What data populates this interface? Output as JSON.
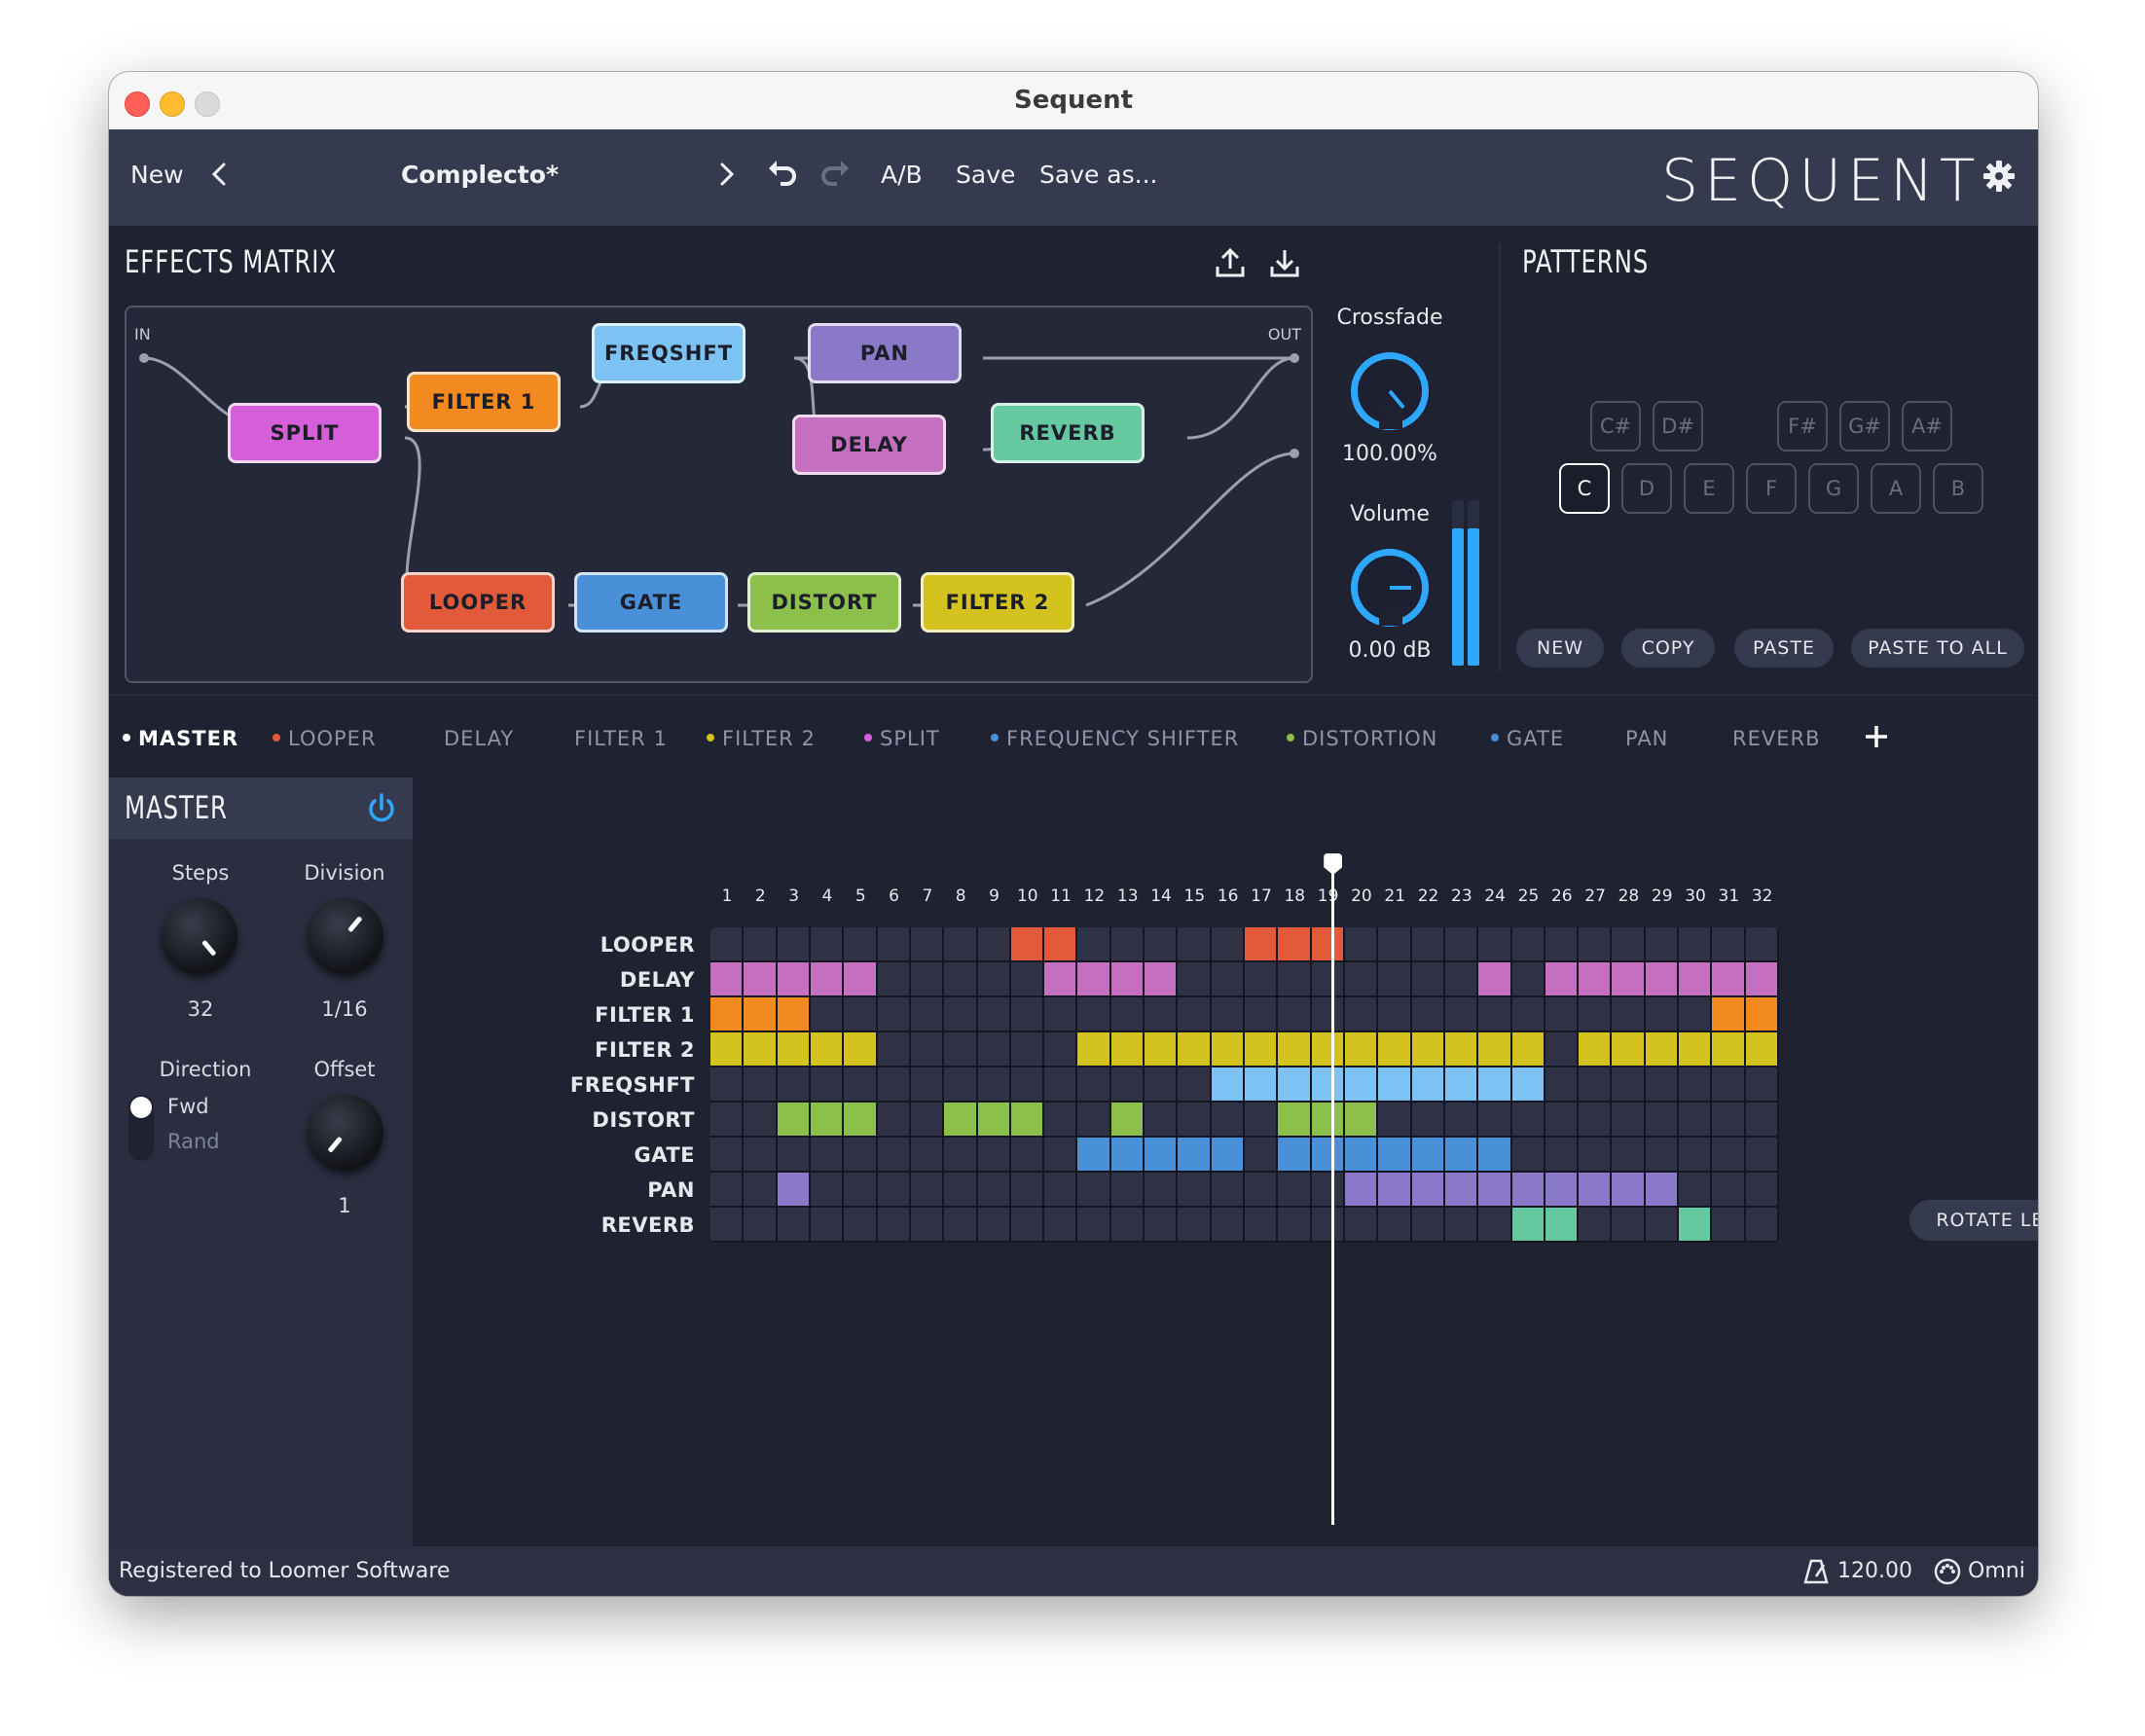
{
  "window": {
    "title": "Sequent"
  },
  "toolbar": {
    "new_label": "New",
    "preset_name": "Complecto*",
    "ab_label": "A/B",
    "save_label": "Save",
    "save_as_label": "Save as...",
    "brand": "SEQUENT"
  },
  "effects_matrix": {
    "title": "EFFECTS MATRIX",
    "in_label": "IN",
    "out_label": "OUT",
    "nodes": [
      {
        "id": "split",
        "label": "SPLIT",
        "color": "#d45fd8"
      },
      {
        "id": "filter1",
        "label": "FILTER 1",
        "color": "#f28a1f"
      },
      {
        "id": "freqshft",
        "label": "FREQSHFT",
        "color": "#7cc2f2"
      },
      {
        "id": "pan",
        "label": "PAN",
        "color": "#8a78c8"
      },
      {
        "id": "delay",
        "label": "DELAY",
        "color": "#c56fc0"
      },
      {
        "id": "reverb",
        "label": "REVERB",
        "color": "#66c8a0"
      },
      {
        "id": "looper",
        "label": "LOOPER",
        "color": "#e25a3a"
      },
      {
        "id": "gate",
        "label": "GATE",
        "color": "#4a90d8"
      },
      {
        "id": "distort",
        "label": "DISTORT",
        "color": "#8cc04a"
      },
      {
        "id": "filter2",
        "label": "FILTER 2",
        "color": "#d4c21e"
      }
    ],
    "crossfade_label": "Crossfade",
    "crossfade_value": "100.00%",
    "volume_label": "Volume",
    "volume_value": "0.00 dB",
    "crossfade_level": 1.0,
    "volume_level": 0.75,
    "meter_left_level": 0.83,
    "meter_right_level": 0.83
  },
  "patterns": {
    "title": "PATTERNS",
    "sharps": [
      "C#",
      "D#",
      "F#",
      "G#",
      "A#"
    ],
    "naturals": [
      "C",
      "D",
      "E",
      "F",
      "G",
      "A",
      "B"
    ],
    "active_note": "C",
    "buttons": {
      "new": "NEW",
      "copy": "COPY",
      "paste": "PASTE",
      "paste_all": "PASTE TO ALL"
    }
  },
  "tabs": [
    {
      "label": "MASTER",
      "dot": "#ffffff",
      "active": true
    },
    {
      "label": "LOOPER",
      "dot": "#e25a3a"
    },
    {
      "label": "DELAY",
      "dot": ""
    },
    {
      "label": "FILTER 1",
      "dot": ""
    },
    {
      "label": "FILTER 2",
      "dot": "#d4c21e"
    },
    {
      "label": "SPLIT",
      "dot": "#d45fd8"
    },
    {
      "label": "FREQUENCY SHIFTER",
      "dot": "#4a90d8"
    },
    {
      "label": "DISTORTION",
      "dot": "#8cc04a"
    },
    {
      "label": "GATE",
      "dot": "#4a90d8"
    },
    {
      "label": "PAN",
      "dot": ""
    },
    {
      "label": "REVERB",
      "dot": ""
    }
  ],
  "master": {
    "title": "MASTER",
    "steps_label": "Steps",
    "steps_value": "32",
    "division_label": "Division",
    "division_value": "1/16",
    "direction_label": "Direction",
    "direction_fwd": "Fwd",
    "direction_rand": "Rand",
    "offset_label": "Offset",
    "offset_value": "1"
  },
  "sequencer": {
    "steps": 32,
    "playhead_step": 19,
    "rows": [
      {
        "label": "LOOPER",
        "color": "#e25a3a",
        "on": [
          10,
          11,
          17,
          18,
          19
        ]
      },
      {
        "label": "DELAY",
        "color": "#c56fc0",
        "on": [
          1,
          2,
          3,
          4,
          5,
          11,
          12,
          13,
          14,
          24,
          26,
          27,
          28,
          29,
          30,
          31,
          32
        ]
      },
      {
        "label": "FILTER 1",
        "color": "#f28a1f",
        "on": [
          1,
          2,
          3,
          31,
          32
        ]
      },
      {
        "label": "FILTER 2",
        "color": "#d4c21e",
        "on": [
          1,
          2,
          3,
          4,
          5,
          12,
          13,
          14,
          15,
          16,
          17,
          18,
          19,
          20,
          21,
          22,
          23,
          24,
          25,
          27,
          28,
          29,
          30,
          31,
          32
        ]
      },
      {
        "label": "FREQSHFT",
        "color": "#7cc2f2",
        "on": [
          16,
          17,
          18,
          19,
          20,
          21,
          22,
          23,
          24,
          25
        ]
      },
      {
        "label": "DISTORT",
        "color": "#8cc04a",
        "on": [
          3,
          4,
          5,
          8,
          9,
          10,
          13,
          18,
          19,
          20
        ]
      },
      {
        "label": "GATE",
        "color": "#4a90d8",
        "on": [
          12,
          13,
          14,
          15,
          16,
          18,
          19,
          20,
          21,
          22,
          23,
          24
        ]
      },
      {
        "label": "PAN",
        "color": "#8a78c8",
        "on": [
          3,
          20,
          21,
          22,
          23,
          24,
          25,
          26,
          27,
          28,
          29
        ]
      },
      {
        "label": "REVERB",
        "color": "#66c8a0",
        "on": [
          25,
          26,
          30
        ]
      }
    ],
    "rotate_label": "ROTATE LEFT"
  },
  "status": {
    "registered": "Registered to Loomer Software",
    "tempo": "120.00",
    "midi": "Omni"
  }
}
